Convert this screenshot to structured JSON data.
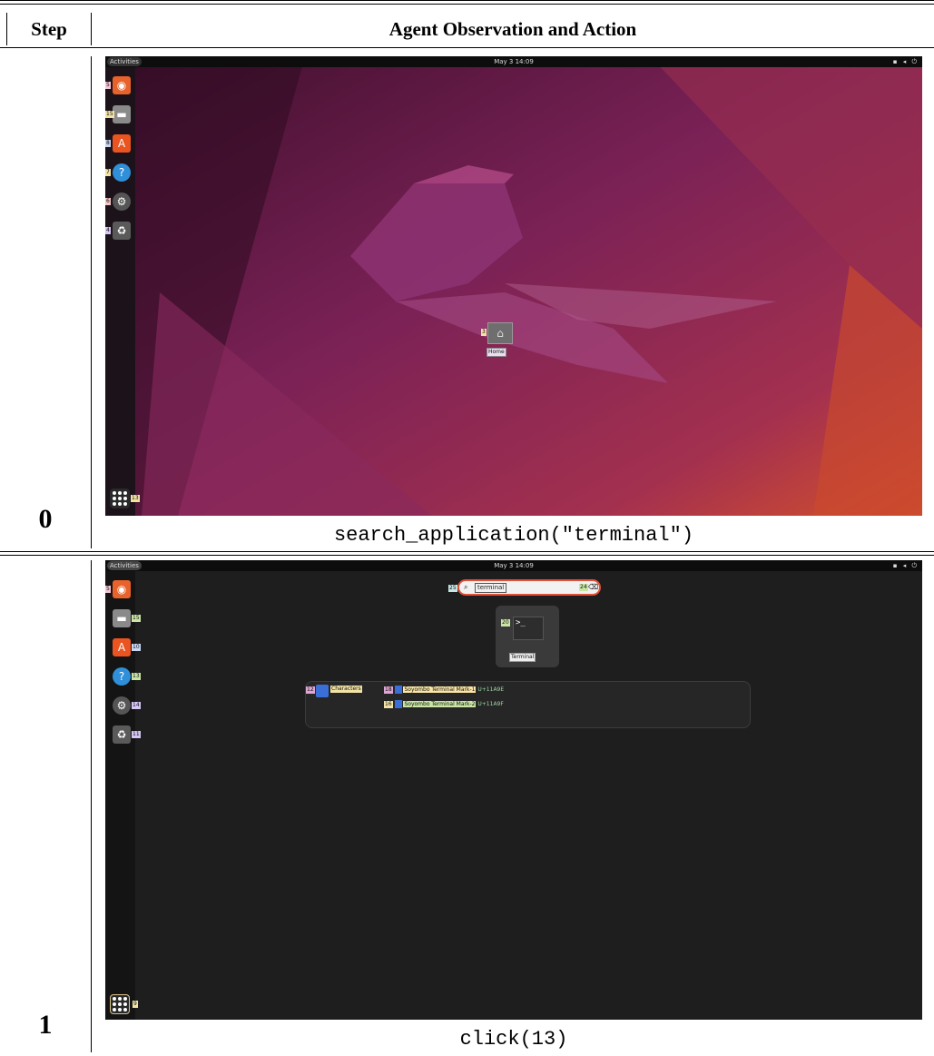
{
  "header": {
    "step": "Step",
    "observation": "Agent Observation and Action"
  },
  "rows": [
    {
      "step": "0",
      "action": "search_application(\"terminal\")",
      "screen": {
        "activities": "Activities",
        "clock": "May 3 14:09",
        "dock": [
          {
            "icon": "firefox-icon",
            "tag": "5"
          },
          {
            "icon": "files-icon",
            "tag": "15"
          },
          {
            "icon": "app-center-icon",
            "tag": "8"
          },
          {
            "icon": "help-icon",
            "tag": "7"
          },
          {
            "icon": "settings-icon",
            "tag": "6"
          },
          {
            "icon": "trash-icon",
            "tag": "4"
          }
        ],
        "apps_tag": "13",
        "desktop_home_label": "Home",
        "desktop_home_tag": "3"
      }
    },
    {
      "step": "1",
      "action": "click(13)",
      "screen": {
        "activities": "Activities",
        "clock": "May 3 14:09",
        "dock": [
          {
            "icon": "firefox-icon",
            "tag": "5"
          },
          {
            "icon": "files-icon",
            "tag": "15"
          },
          {
            "icon": "app-center-icon",
            "tag": "10"
          },
          {
            "icon": "help-icon",
            "tag": "13"
          },
          {
            "icon": "settings-icon",
            "tag": "14"
          },
          {
            "icon": "trash-icon",
            "tag": "11"
          }
        ],
        "apps_tag": "9",
        "search_value": "terminal",
        "search_tag": "25",
        "clear_tag": "24",
        "result_app": "Terminal",
        "result_tag": "20",
        "characters_label": "Characters",
        "characters_tag": "12",
        "char_results": [
          {
            "name": "Soyombo Terminal Mark-1",
            "code": "U+11A9E",
            "tag": "18"
          },
          {
            "name": "Soyombo Terminal Mark-2",
            "code": "U+11A9F",
            "tag": "16"
          }
        ]
      }
    }
  ],
  "colors": {
    "accent": "#e0503a",
    "ubuntu_wall": "#7a2156",
    "overview_bg": "#1e1e1e"
  }
}
